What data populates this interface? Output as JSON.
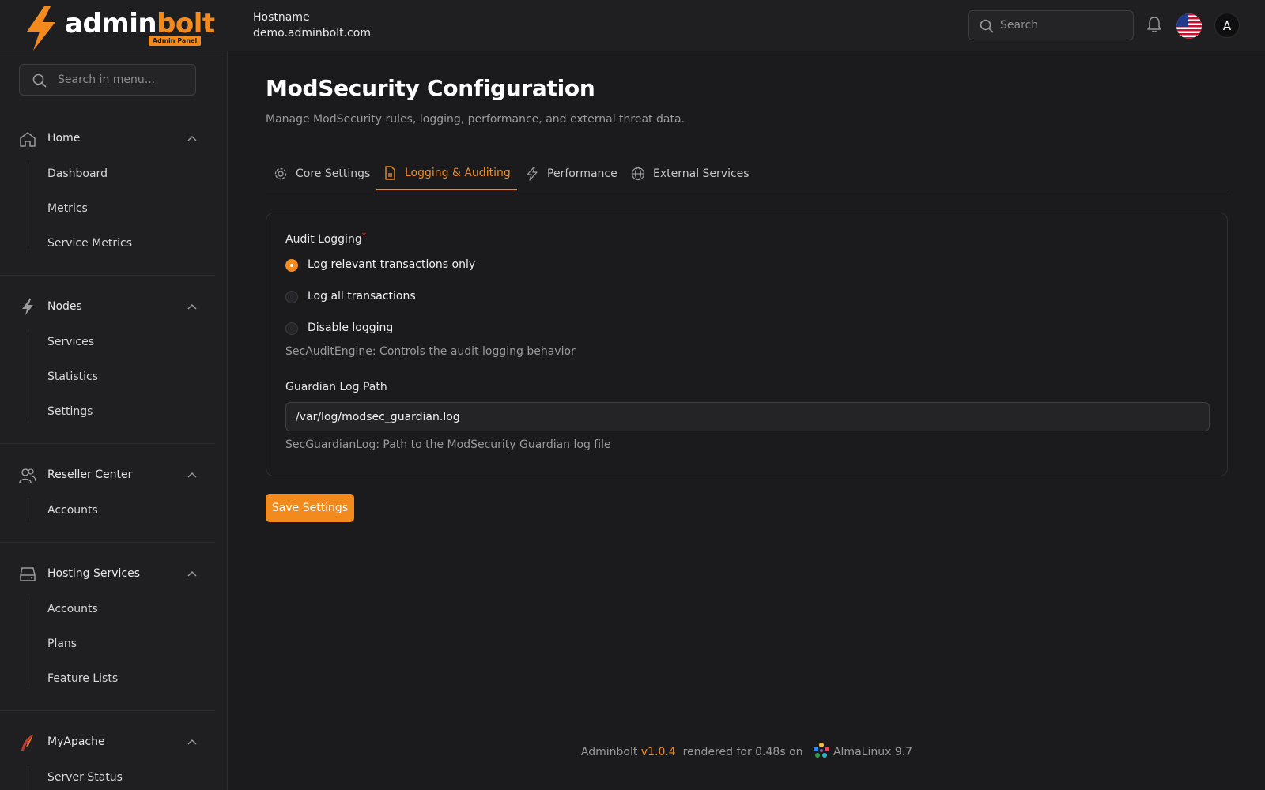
{
  "brand": {
    "name_part1": "admin",
    "name_part2": "bolt",
    "badge": "Admin Panel"
  },
  "header": {
    "hostname_label": "Hostname",
    "hostname_value": "demo.adminbolt.com",
    "search_placeholder": "Search",
    "avatar_initial": "A",
    "icons": [
      "search-icon",
      "bell-icon",
      "us-flag-icon"
    ]
  },
  "sidebar": {
    "search_placeholder": "Search in menu...",
    "sections": [
      {
        "label": "Home",
        "icon": "home-icon",
        "items": [
          "Dashboard",
          "Metrics",
          "Service Metrics"
        ]
      },
      {
        "label": "Nodes",
        "icon": "bolt-icon",
        "items": [
          "Services",
          "Statistics",
          "Settings"
        ]
      },
      {
        "label": "Reseller Center",
        "icon": "users-icon",
        "items": [
          "Accounts"
        ]
      },
      {
        "label": "Hosting Services",
        "icon": "server-icon",
        "items": [
          "Accounts",
          "Plans",
          "Feature Lists"
        ]
      },
      {
        "label": "MyApache",
        "icon": "apache-feather-icon",
        "items": [
          "Server Status"
        ]
      }
    ]
  },
  "page": {
    "title": "ModSecurity Configuration",
    "subtitle": "Manage ModSecurity rules, logging, performance, and external threat data."
  },
  "tabs": [
    {
      "label": "Core Settings",
      "icon": "gear-icon",
      "active": false
    },
    {
      "label": "Logging & Auditing",
      "icon": "document-icon",
      "active": true
    },
    {
      "label": "Performance",
      "icon": "bolt-icon",
      "active": false
    },
    {
      "label": "External Services",
      "icon": "globe-icon",
      "active": false
    }
  ],
  "form": {
    "audit_label": "Audit Logging",
    "required_mark": "*",
    "audit_options": [
      "Log relevant transactions only",
      "Log all transactions",
      "Disable logging"
    ],
    "audit_selected": "Log relevant transactions only",
    "audit_help": "SecAuditEngine: Controls the audit logging behavior",
    "guardian_label": "Guardian Log Path",
    "guardian_value": "/var/log/modsec_guardian.log",
    "guardian_help": "SecGuardianLog: Path to the ModSecurity Guardian log file",
    "save_label": "Save Settings"
  },
  "footer": {
    "app": "Adminbolt",
    "version": "v1.0.4",
    "rendered": "rendered for 0.48s on",
    "os": "AlmaLinux 9.7"
  },
  "colors": {
    "accent": "#f28a1e",
    "background": "#1b1b1d",
    "panel": "#1f1f21",
    "required": "#e24b4b"
  }
}
